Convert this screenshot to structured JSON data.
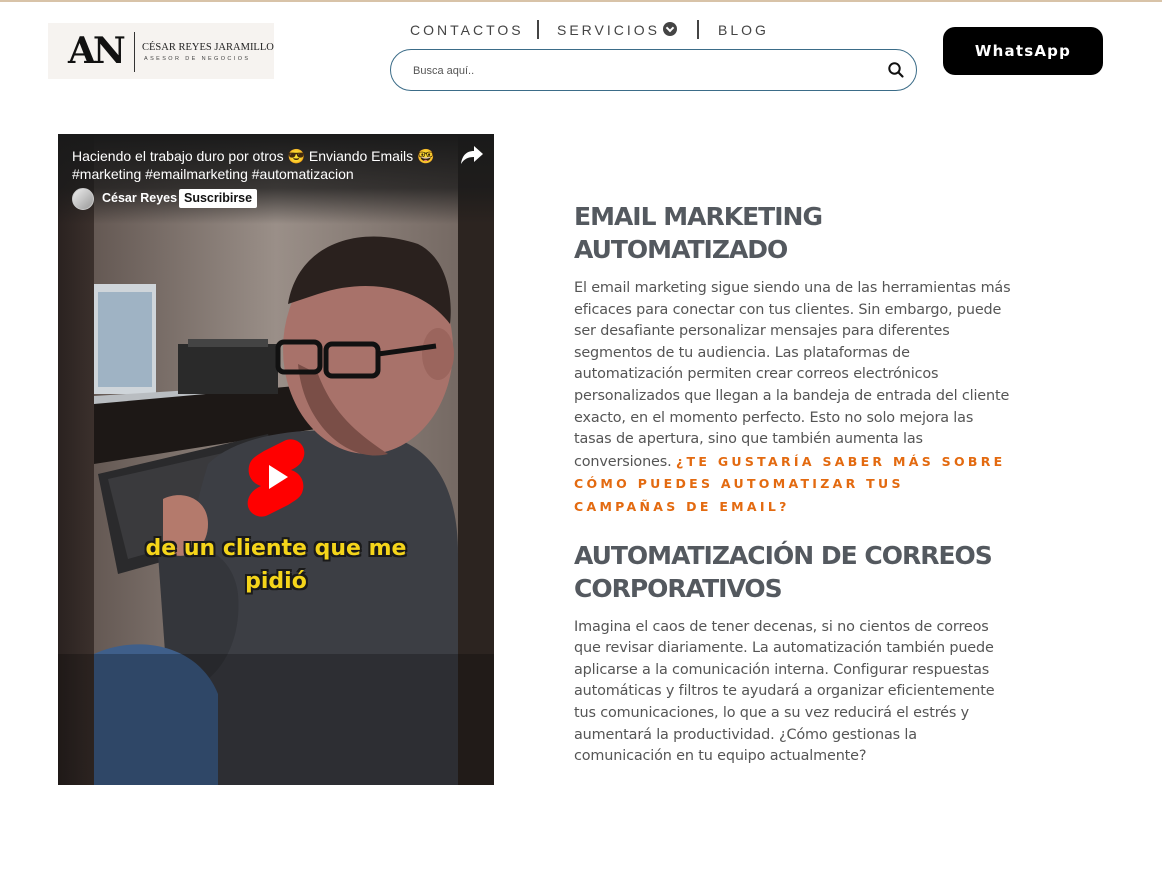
{
  "header": {
    "logo": {
      "mark": "AN",
      "name": "CÉSAR REYES JARAMILLO",
      "tagline": "ASESOR DE NEGOCIOS"
    },
    "nav": [
      {
        "label": "CONTACTOS"
      },
      {
        "label": "SERVICIOS"
      },
      {
        "label": "BLOG"
      }
    ],
    "search": {
      "placeholder": "Busca aquí..",
      "value": ""
    },
    "whatsapp_label": "WhatsApp"
  },
  "video": {
    "title": "Haciendo el trabajo duro por otros 😎 Enviando Emails 🤓 #marketing #emailmarketing #automatizacion",
    "channel": "César Reyes",
    "subscribe_label": "Suscribirse",
    "caption_line1": "de un cliente que me",
    "caption_line2": "pidió"
  },
  "article": {
    "heading1": "EMAIL MARKETING AUTOMATIZADO",
    "para1": "El email marketing sigue siendo una de las herramientas más eficaces para conectar con tus clientes. Sin embargo, puede ser desafiante personalizar mensajes para diferentes segmentos de tu audiencia. Las plataformas de automatización permiten crear correos electrónicos personalizados que llegan a la bandeja de entrada del cliente exacto, en el momento perfecto. Esto no solo mejora las tasas de apertura, sino que también aumenta las conversiones.",
    "cta": "¿TE GUSTARÍA SABER MÁS SOBRE CÓMO PUEDES AUTOMATIZAR TUS CAMPAÑAS DE EMAIL?",
    "heading2": "AUTOMATIZACIÓN DE CORREOS CORPORATIVOS",
    "para2": "Imagina el caos de tener decenas, si no cientos de correos que revisar diariamente. La automatización también puede aplicarse a la comunicación interna. Configurar respuestas automáticas y filtros te ayudará a organizar eficientemente tus comunicaciones, lo que a su vez reducirá el estrés y aumentará la productividad. ¿Cómo gestionas la comunicación en tu equipo actualmente?"
  },
  "colors": {
    "heading": "#54595f",
    "cta": "#e36a10",
    "search_border": "#3b6c88",
    "whatsapp_bg": "#000000",
    "caption": "#f5d51a",
    "play_red": "#ff0000"
  }
}
